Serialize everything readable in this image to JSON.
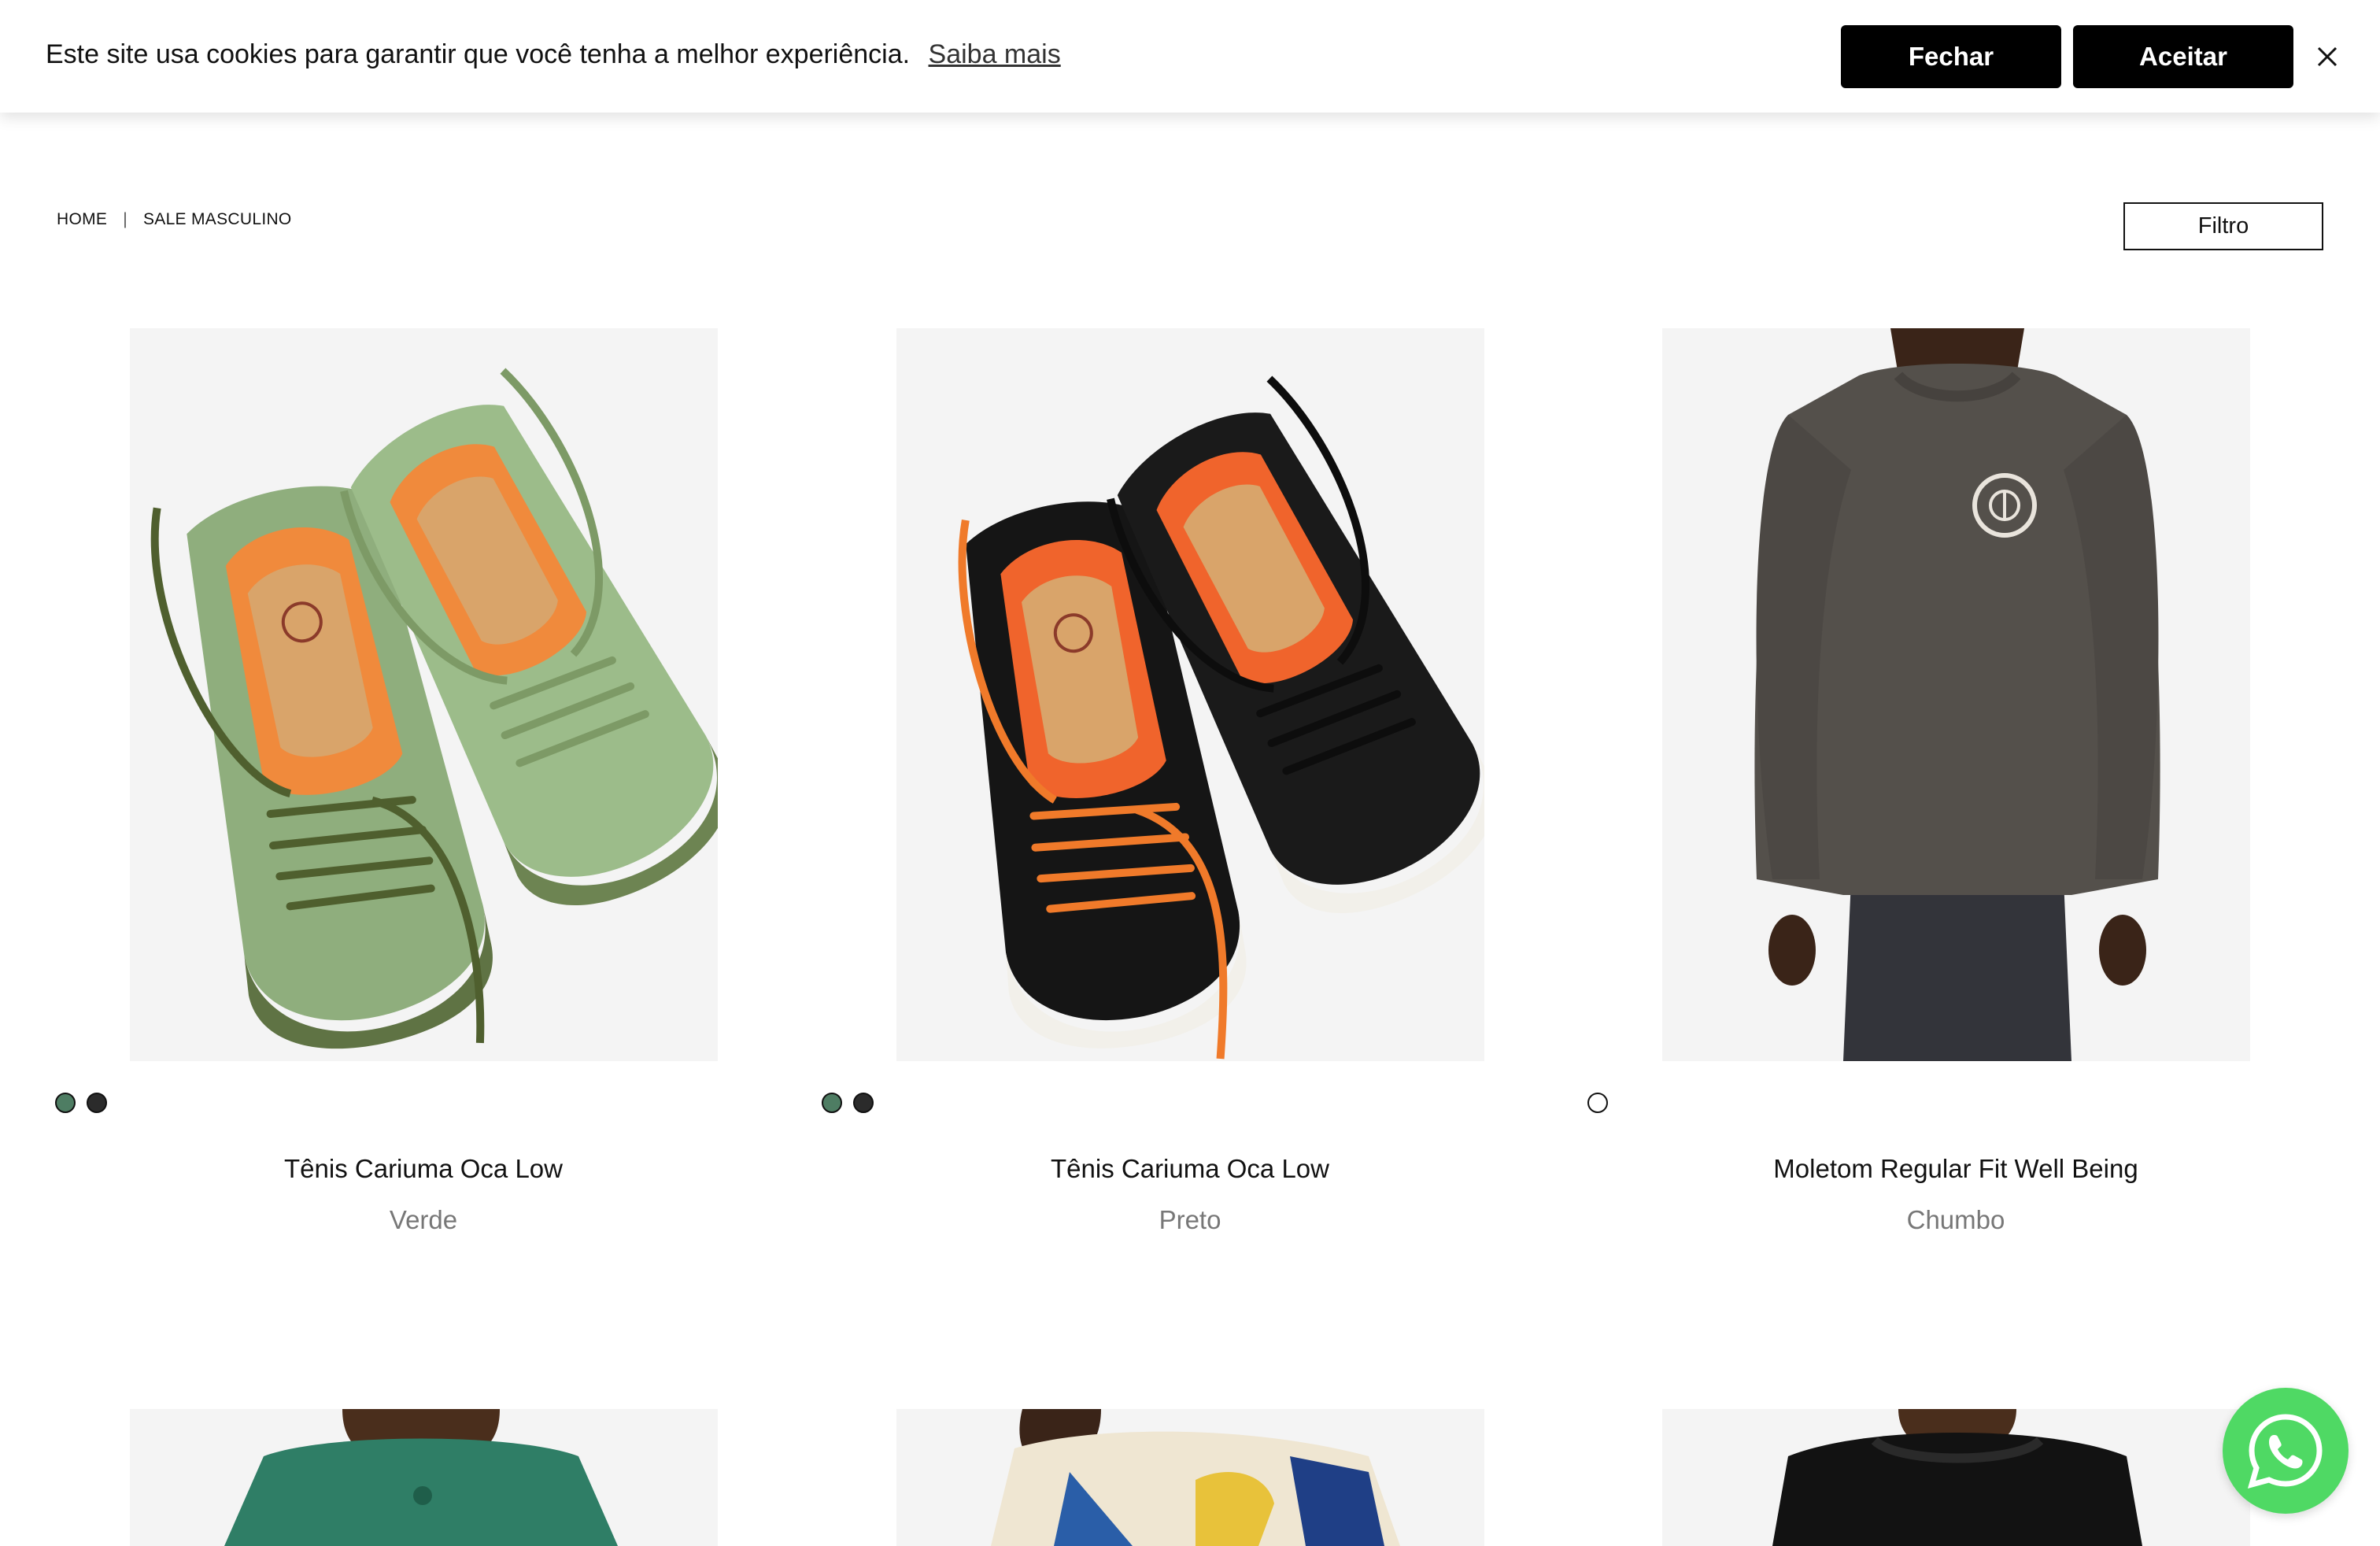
{
  "cookie": {
    "message": "Este site usa cookies para garantir que você tenha a melhor experiência.",
    "learn_more": "Saiba mais",
    "close_label": "Fechar",
    "accept_label": "Aceitar"
  },
  "breadcrumb": {
    "home": "HOME",
    "separator": "|",
    "current": "SALE MASCULINO"
  },
  "filter_label": "Filtro",
  "products": [
    {
      "name": "Tênis Cariuma Oca Low",
      "color": "Verde",
      "swatches": [
        "#4e7d63",
        "#2b2b2b"
      ]
    },
    {
      "name": "Tênis Cariuma Oca Low",
      "color": "Preto",
      "swatches": [
        "#4e7d63",
        "#2b2b2b"
      ]
    },
    {
      "name": "Moletom Regular Fit Well Being",
      "color": "Chumbo",
      "swatches": [
        "#ffffff"
      ]
    }
  ],
  "icons": {
    "close": "close-icon",
    "whatsapp": "whatsapp-icon"
  },
  "colors": {
    "button_bg": "#000000",
    "whatsapp_green": "#4fd964",
    "image_bg": "#f4f4f4"
  }
}
